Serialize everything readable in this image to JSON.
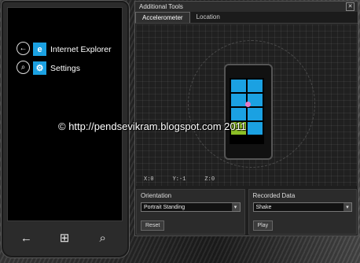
{
  "phone": {
    "apps": [
      {
        "label": "Internet Explorer",
        "icon": "internet-explorer-icon"
      },
      {
        "label": "Settings",
        "icon": "settings-icon"
      }
    ],
    "nav": {
      "back": "back-icon",
      "start": "windows-start-icon",
      "search": "search-icon"
    }
  },
  "tools": {
    "title": "Additional Tools",
    "tabs": [
      {
        "label": "Accelerometer"
      },
      {
        "label": "Location"
      }
    ],
    "readout": {
      "x": "X:0",
      "y": "Y:-1",
      "z": "Z:0"
    },
    "orientation": {
      "header": "Orientation",
      "selected": "Portrait Standing",
      "reset_label": "Reset"
    },
    "recorded": {
      "header": "Recorded Data",
      "selected": "Shake",
      "play_label": "Play"
    }
  },
  "watermark": "© http://pendsevikram.blogspot.com 2011"
}
